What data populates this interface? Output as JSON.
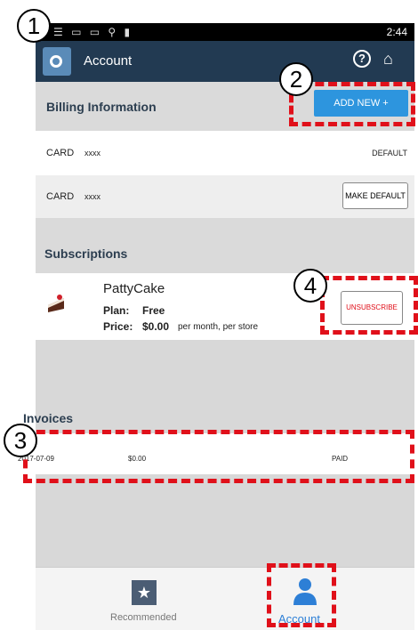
{
  "status": {
    "left_icons": "☰ ▭ ▭ ⚲ ▮",
    "right_text": "2:44"
  },
  "appbar": {
    "title": "Account",
    "help_glyph": "?",
    "home_glyph": "⌂"
  },
  "billing": {
    "header": "Billing Information",
    "add_button": "ADD NEW +",
    "cards": [
      {
        "label": "CARD",
        "number": "xxxx",
        "status": "DEFAULT"
      },
      {
        "label": "CARD",
        "number": "xxxx",
        "action": "MAKE DEFAULT"
      }
    ]
  },
  "subscriptions": {
    "header": "Subscriptions",
    "item": {
      "name": "PattyCake",
      "plan_label": "Plan:",
      "plan_value": "Free",
      "price_label": "Price:",
      "price_value": "$0.00",
      "price_suffix": "per month, per store",
      "action": "UNSUBSCRIBE"
    }
  },
  "invoices": {
    "header": "Invoices",
    "rows": [
      {
        "date": "2017-07-09",
        "amount": "$0.00",
        "status": "PAID"
      }
    ]
  },
  "navbar": {
    "items": [
      {
        "label": "Recommended"
      },
      {
        "label": "Account"
      }
    ]
  },
  "callouts": [
    "1",
    "2",
    "3",
    "4"
  ],
  "colors": {
    "appbar": "#223a52",
    "accent": "#2d95de",
    "annotation": "#e0101a"
  }
}
